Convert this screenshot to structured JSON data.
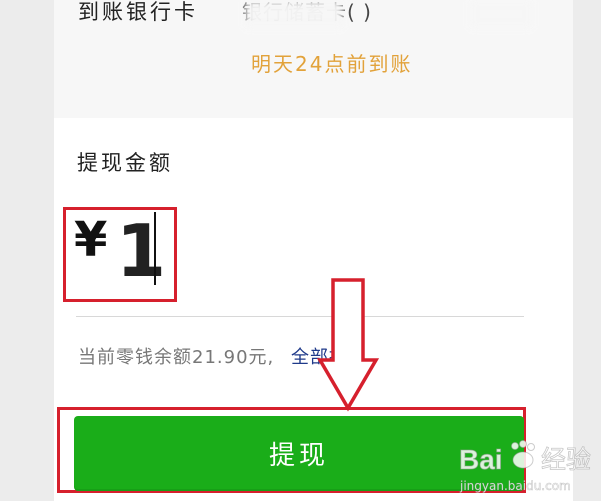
{
  "bank": {
    "label": "到账银行卡",
    "value": "银行储蓄卡(  )",
    "arrival_note": "明天24点前到账"
  },
  "amount": {
    "label": "提现金额",
    "currency_symbol": "¥",
    "value": "1"
  },
  "balance": {
    "text": "当前零钱余额21.90元,",
    "withdraw_all_label": "全部提现"
  },
  "submit": {
    "label": "提现"
  },
  "watermark": {
    "brand": "Bai",
    "brand_suffix": "经验",
    "site": "jingyan.baidu.com"
  },
  "colors": {
    "accent_green": "#1aad19",
    "highlight_red": "#d6202d",
    "arrival_orange": "#e2a23a",
    "link_blue": "#1f3a8a"
  }
}
